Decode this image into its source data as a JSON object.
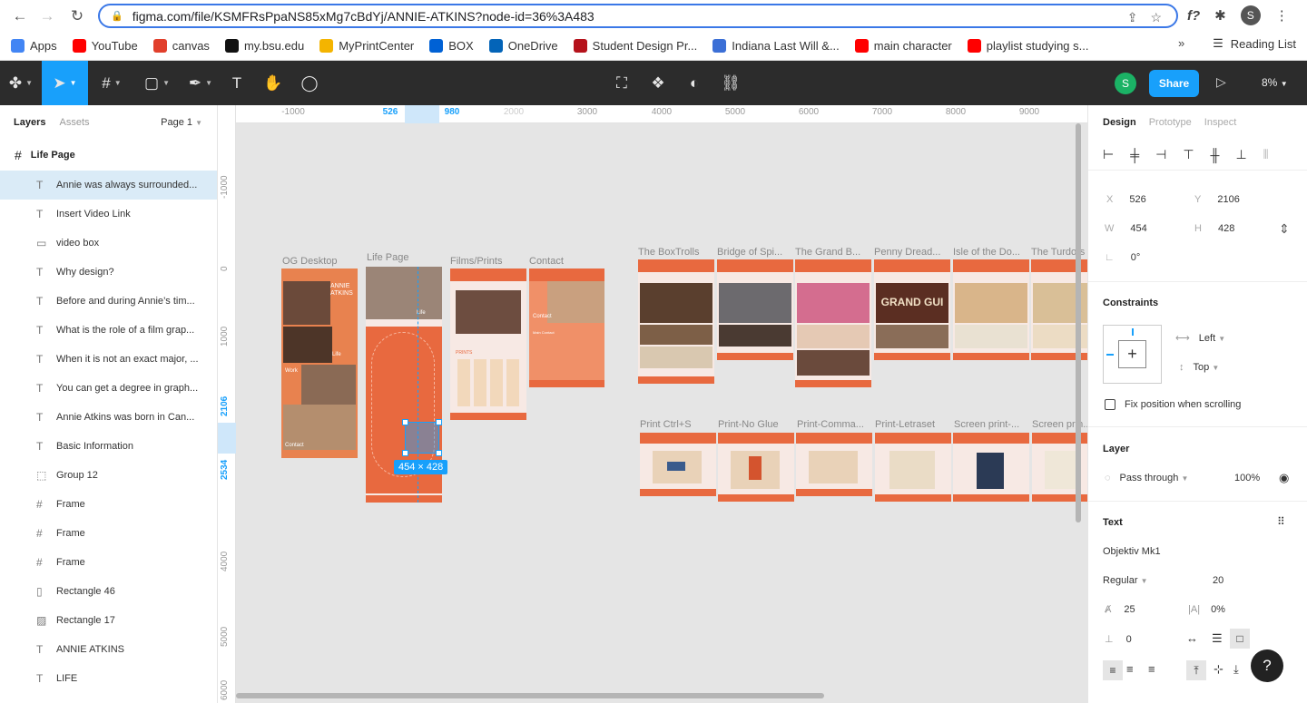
{
  "browser": {
    "url": "figma.com/file/KSMFRsPpaNS85xMg7cBdYj/ANNIE-ATKINS?node-id=36%3A483",
    "profile_initial": "S",
    "bookmarks": [
      {
        "label": "Apps",
        "color": "#4285f4"
      },
      {
        "label": "YouTube",
        "color": "#ff0000"
      },
      {
        "label": "canvas",
        "color": "#e13f2b"
      },
      {
        "label": "my.bsu.edu",
        "color": "#111111"
      },
      {
        "label": "MyPrintCenter",
        "color": "#f4b400"
      },
      {
        "label": "BOX",
        "color": "#0061d5"
      },
      {
        "label": "OneDrive",
        "color": "#0364b8"
      },
      {
        "label": "Student Design Pr...",
        "color": "#b5121b"
      },
      {
        "label": "Indiana Last Will &...",
        "color": "#3b6fd6"
      },
      {
        "label": "main character",
        "color": "#ff0000"
      },
      {
        "label": "playlist studying s...",
        "color": "#ff0000"
      }
    ],
    "more_bookmarks": "»",
    "reading_list": "Reading List"
  },
  "toolbar": {
    "user_initial": "S",
    "share_label": "Share",
    "zoom_label": "8%"
  },
  "left_panel": {
    "tabs": [
      "Layers",
      "Assets"
    ],
    "page_selector": "Page 1",
    "frame_name": "Life Page",
    "layers": [
      {
        "icon": "T",
        "name": "Annie was always surrounded..."
      },
      {
        "icon": "T",
        "name": "Insert Video Link"
      },
      {
        "icon": "▭",
        "name": "video box"
      },
      {
        "icon": "T",
        "name": "Why design?"
      },
      {
        "icon": "T",
        "name": "Before and during Annie’s tim..."
      },
      {
        "icon": "T",
        "name": "What is the role of a film grap..."
      },
      {
        "icon": "T",
        "name": "When it is not an exact major, ..."
      },
      {
        "icon": "T",
        "name": "You can get a degree in graph..."
      },
      {
        "icon": "T",
        "name": "Annie Atkins was born in Can..."
      },
      {
        "icon": "T",
        "name": "Basic Information"
      },
      {
        "icon": "⬚",
        "name": "Group 12"
      },
      {
        "icon": "#",
        "name": "Frame"
      },
      {
        "icon": "#",
        "name": "Frame"
      },
      {
        "icon": "#",
        "name": "Frame"
      },
      {
        "icon": "▯",
        "name": "Rectangle 46"
      },
      {
        "icon": "▨",
        "name": "Rectangle 17"
      },
      {
        "icon": "T",
        "name": "ANNIE ATKINS"
      },
      {
        "icon": "T",
        "name": "LIFE"
      }
    ]
  },
  "canvas": {
    "ruler_top": [
      "-1000",
      "526",
      "980",
      "2000",
      "3000",
      "4000",
      "5000",
      "6000",
      "7000",
      "8000",
      "9000"
    ],
    "ruler_left": [
      "-1000",
      "0",
      "1000",
      "2106",
      "2534",
      "4000",
      "5000",
      "6000"
    ],
    "selection_size": "454 × 428",
    "frames_row1": [
      "OG Desktop",
      "Life Page",
      "Films/Prints",
      "Contact",
      "The BoxTrolls",
      "Bridge of Spi...",
      "The Grand B...",
      "Penny Dread...",
      "Isle of the Do...",
      "The Turdors"
    ],
    "frames_row2": [
      "Print Ctrl+S",
      "Print-No Glue",
      "Print-Comma...",
      "Print-Letraset",
      "Screen print-...",
      "Screen prin..."
    ],
    "og_texts": {
      "title": "ANNIE ATKINS",
      "life": "Life",
      "work": "Work",
      "contact": "Contact"
    },
    "life_texts": {
      "life": "Life"
    },
    "films_texts": {
      "prints": "PRINTS"
    },
    "contact_texts": {
      "contact": "Contact",
      "main_contact": "Main Contact"
    },
    "penny_sign": "GRAND GUI"
  },
  "right_panel": {
    "tabs": [
      "Design",
      "Prototype",
      "Inspect"
    ],
    "x_label": "X",
    "x": "526",
    "y_label": "Y",
    "y": "2106",
    "w_label": "W",
    "w": "454",
    "h_label": "H",
    "h": "428",
    "rotation": "0°",
    "constraints_title": "Constraints",
    "constraint_h": "Left",
    "constraint_v": "Top",
    "fix_position": "Fix position when scrolling",
    "layer_title": "Layer",
    "blend_mode": "Pass through",
    "opacity": "100%",
    "text_title": "Text",
    "font_family": "Objektiv Mk1",
    "font_weight": "Regular",
    "font_size": "20",
    "line_height": "25",
    "letter_spacing": "0%",
    "paragraph_spacing": "0"
  },
  "help_label": "?"
}
